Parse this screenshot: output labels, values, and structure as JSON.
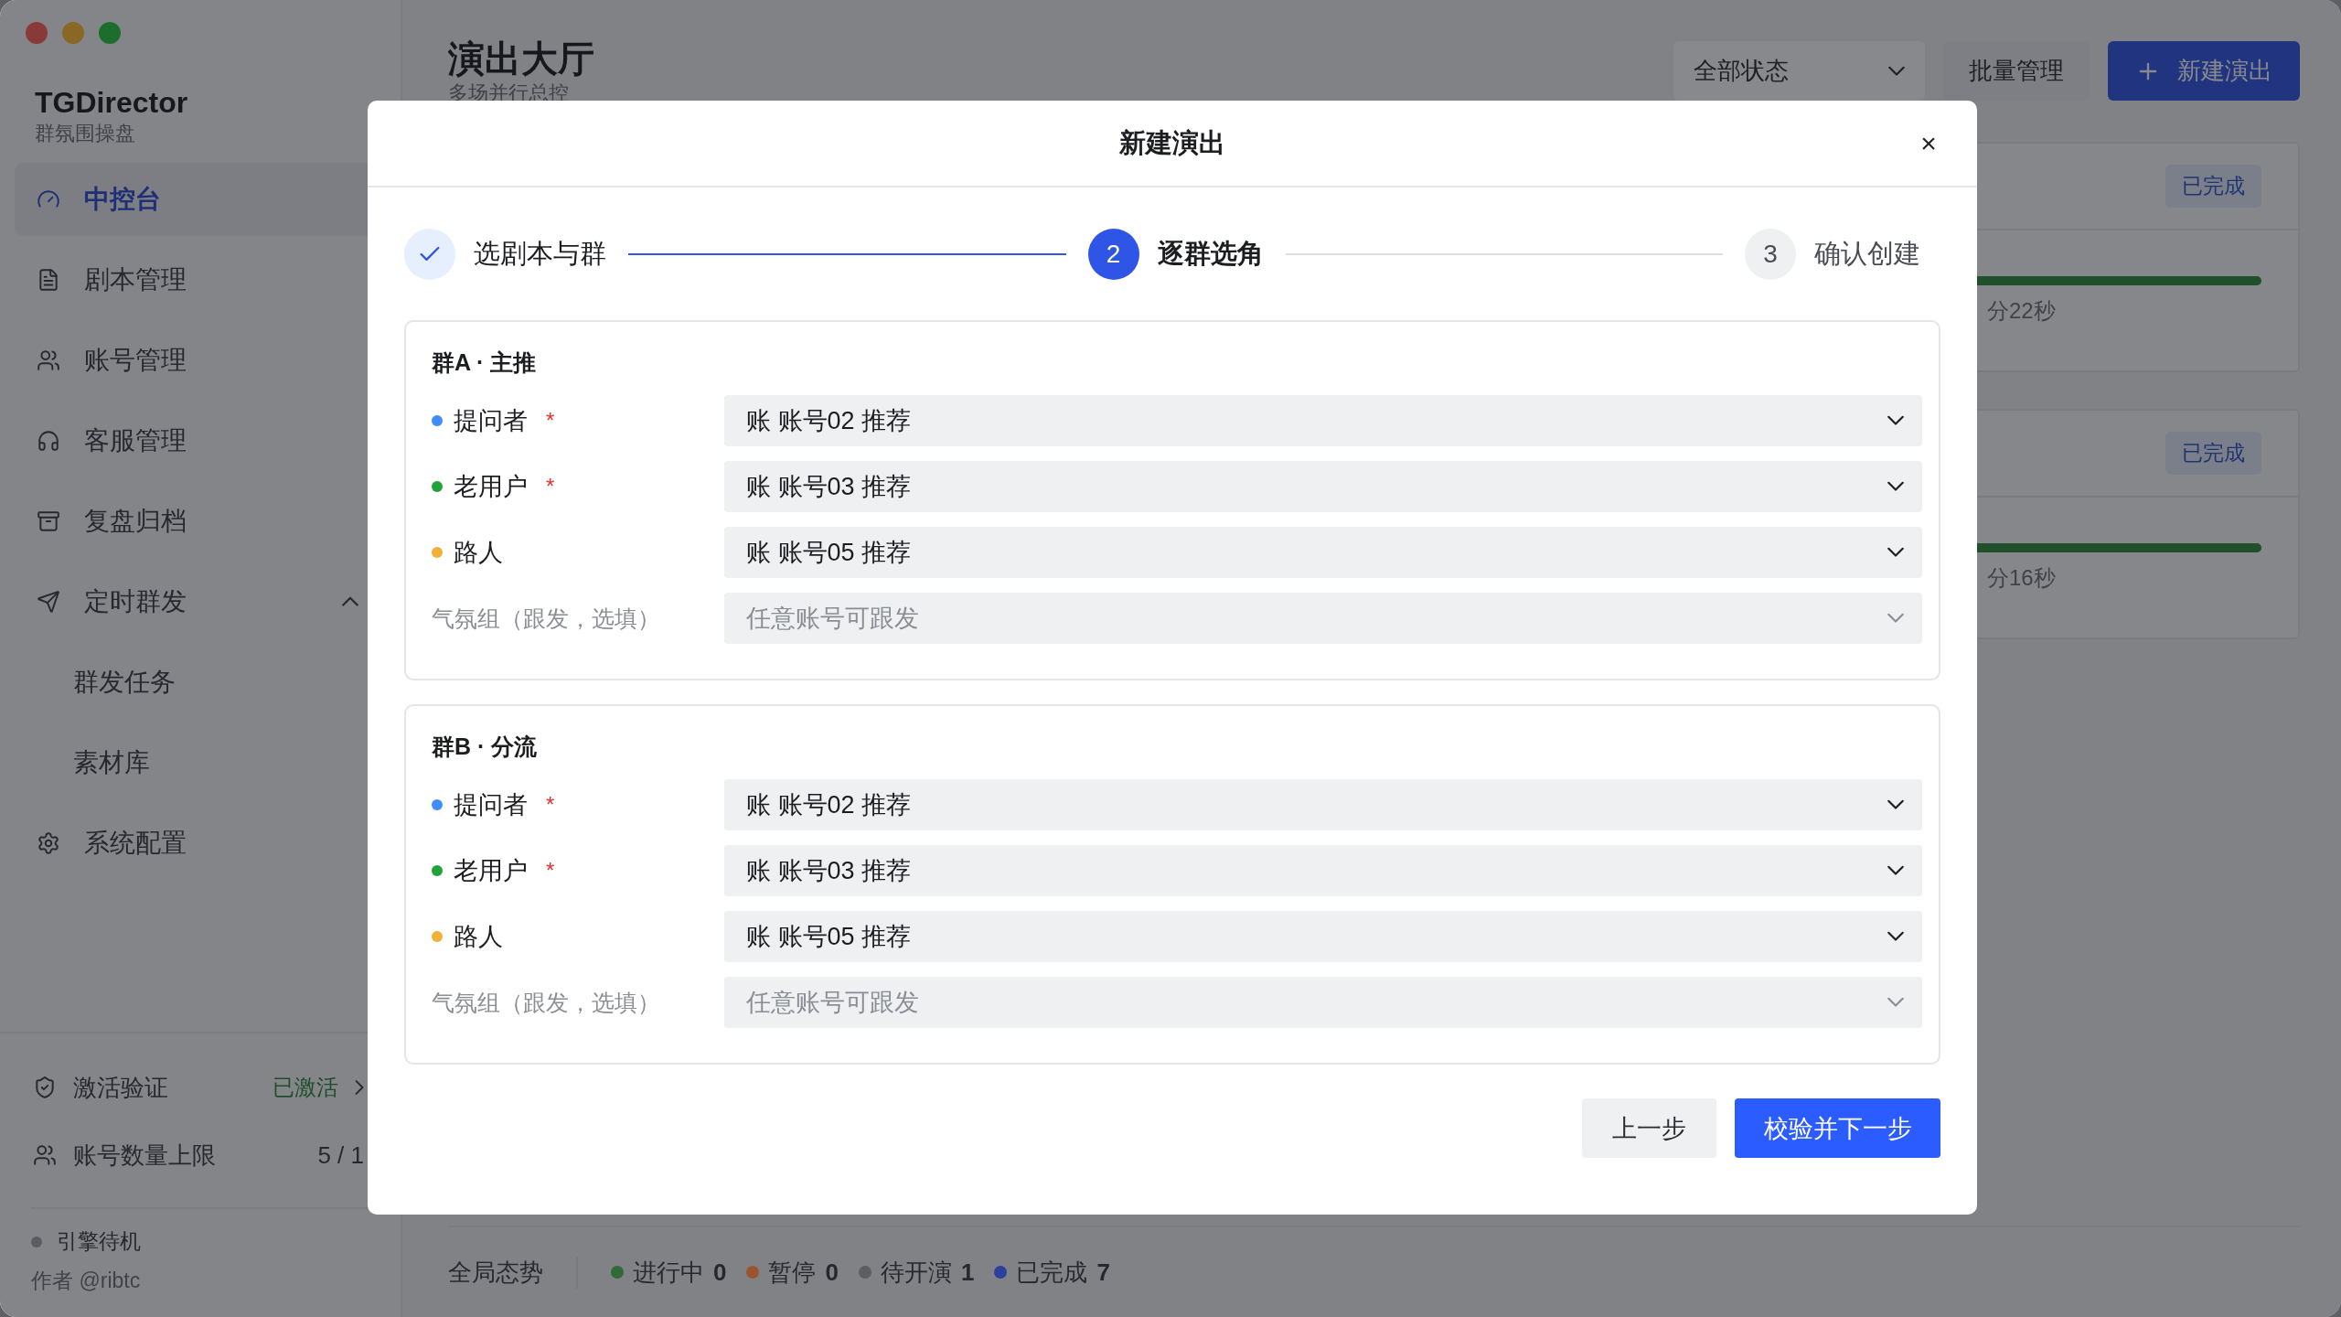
{
  "sidebar": {
    "app_name": "TGDirector",
    "app_subtitle": "群氛围操盘",
    "nav": [
      {
        "label": "中控台",
        "selected": true
      },
      {
        "label": "剧本管理",
        "selected": false
      },
      {
        "label": "账号管理",
        "selected": false
      },
      {
        "label": "客服管理",
        "selected": false
      },
      {
        "label": "复盘归档",
        "selected": false
      },
      {
        "label": "定时群发",
        "selected": false,
        "expanded": true,
        "children": [
          {
            "label": "群发任务",
            "selected": false
          },
          {
            "label": "素材库",
            "selected": false
          }
        ]
      },
      {
        "label": "系统配置",
        "selected": false
      }
    ],
    "activation": {
      "label": "激活验证",
      "status": "已激活"
    },
    "quota": {
      "label": "账号数量上限",
      "value": "5 / 1"
    },
    "engine": {
      "label": "引擎待机",
      "color": "#5a5c61"
    },
    "author": "作者 @ribtc"
  },
  "main": {
    "title": "演出大厅",
    "subtitle": "多场并行总控",
    "status_filter": "全部状态",
    "batch_button": "批量管理",
    "new_button": "新建演出",
    "cards": [
      {
        "badge": "已完成",
        "level": 1,
        "time": "分22秒"
      },
      {
        "badge": "已完成",
        "level": 1,
        "time": "分16秒"
      }
    ],
    "status_bar": {
      "label": "全局态势",
      "items": [
        {
          "label": "进行中",
          "count": "0",
          "color": "#2f6a37"
        },
        {
          "label": "暂停",
          "count": "0",
          "color": "#9a5530"
        },
        {
          "label": "待开演",
          "count": "1",
          "color": "#5c5e63"
        },
        {
          "label": "已完成",
          "count": "7",
          "color": "#2b3f9c"
        }
      ]
    }
  },
  "modal": {
    "title": "新建演出",
    "close": "×",
    "steps": [
      {
        "label": "选剧本与群",
        "completed": true,
        "selected": false
      },
      {
        "label": "逐群选角",
        "completed": false,
        "selected": true,
        "number": "2"
      },
      {
        "label": "确认创建",
        "completed": false,
        "selected": false,
        "number": "3"
      }
    ],
    "groups": [
      {
        "title": "群A · 主推",
        "rows": [
          {
            "kind": "role",
            "name": "提问者",
            "color": "#3f8cff",
            "mark": "*",
            "value": "账 账号02 推荐"
          },
          {
            "kind": "role",
            "name": "老用户",
            "color": "#22a33a",
            "mark": "*",
            "value": "账 账号03 推荐"
          },
          {
            "kind": "role",
            "name": "路人",
            "color": "#f2b134",
            "value": "账 账号05 推荐"
          },
          {
            "kind": "optional",
            "name": "气氛组（跟发，选填）",
            "placeholder": "任意账号可跟发"
          }
        ]
      },
      {
        "title": "群B · 分流",
        "rows": [
          {
            "kind": "role",
            "name": "提问者",
            "color": "#3f8cff",
            "mark": "*",
            "value": "账 账号02 推荐"
          },
          {
            "kind": "role",
            "name": "老用户",
            "color": "#22a33a",
            "mark": "*",
            "value": "账 账号03 推荐"
          },
          {
            "kind": "role",
            "name": "路人",
            "color": "#f2b134",
            "value": "账 账号05 推荐"
          },
          {
            "kind": "optional",
            "name": "气氛组（跟发，选填）",
            "placeholder": "任意账号可跟发"
          }
        ]
      }
    ],
    "back_button": "上一步",
    "next_button": "校验并下一步"
  }
}
